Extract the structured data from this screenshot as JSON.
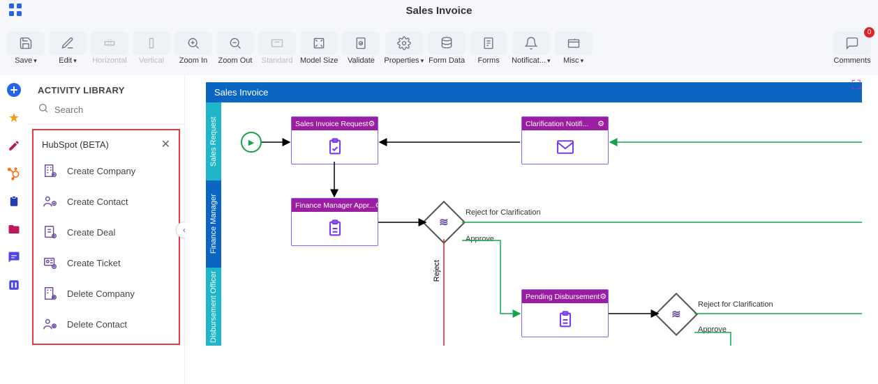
{
  "header": {
    "title": "Sales Invoice"
  },
  "toolbar": {
    "save": "Save",
    "edit": "Edit",
    "horizontal": "Horizontal",
    "vertical": "Vertical",
    "zoom_in": "Zoom In",
    "zoom_out": "Zoom Out",
    "standard": "Standard",
    "model_size": "Model Size",
    "validate": "Validate",
    "properties": "Properties",
    "form_data": "Form Data",
    "forms": "Forms",
    "notifications": "Notificat...",
    "misc": "Misc",
    "comments": "Comments",
    "comments_count": "0"
  },
  "sidebar": {
    "heading": "ACTIVITY LIBRARY",
    "search_placeholder": "Search",
    "group_title": "HubSpot (BETA)",
    "items": [
      {
        "label": "Create Company"
      },
      {
        "label": "Create Contact"
      },
      {
        "label": "Create Deal"
      },
      {
        "label": "Create Ticket"
      },
      {
        "label": "Delete Company"
      },
      {
        "label": "Delete Contact"
      }
    ]
  },
  "process": {
    "pool_name": "Sales Invoice",
    "lanes": [
      "Sales Request",
      "Finance Manager",
      "Disbursement Officer"
    ],
    "tasks": {
      "t1": "Sales Invoice Request",
      "t2": "Clarification Notifi...",
      "t3": "Finance Manager Appr...",
      "t4": "Pending Disbursement"
    },
    "labels": {
      "reject_clar": "Reject for Clarification",
      "approve": "Approve",
      "reject": "Reject"
    }
  }
}
